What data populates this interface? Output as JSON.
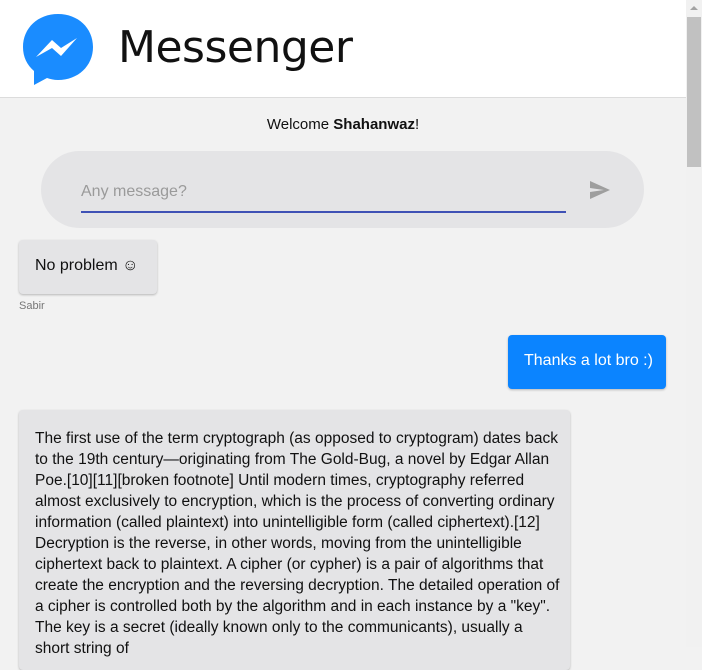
{
  "header": {
    "app_title": "Messenger",
    "logo_icon": "messenger-logo-icon",
    "logo_color": "#1a8cff"
  },
  "welcome": {
    "prefix": "Welcome ",
    "username": "Shahanwaz",
    "suffix": "!"
  },
  "composer": {
    "placeholder": "Any message?",
    "value": "",
    "send_icon": "send-icon",
    "underline_color": "#3f51b5"
  },
  "messages": [
    {
      "direction": "incoming",
      "text": "No problem ☺",
      "sender": "Sabir"
    },
    {
      "direction": "outgoing",
      "text": "Thanks a lot bro :)"
    },
    {
      "direction": "incoming",
      "text": "The first use of the term cryptograph (as opposed to cryptogram) dates back to the 19th century—originating from The Gold-Bug, a novel by Edgar Allan Poe.[10][11][broken footnote] Until modern times, cryptography referred almost exclusively to encryption, which is the process of converting ordinary information (called plaintext) into unintelligible form (called ciphertext).[12] Decryption is the reverse, in other words, moving from the unintelligible ciphertext back to plaintext. A cipher (or cypher) is a pair of algorithms that create the encryption and the reversing decryption. The detailed operation of a cipher is controlled both by the algorithm and in each instance by a \"key\". The key is a secret (ideally known only to the communicants), usually a short string of"
    }
  ],
  "colors": {
    "incoming_bubble": "#e4e4e6",
    "outgoing_bubble": "#0b84ff",
    "background": "#f2f2f2"
  }
}
